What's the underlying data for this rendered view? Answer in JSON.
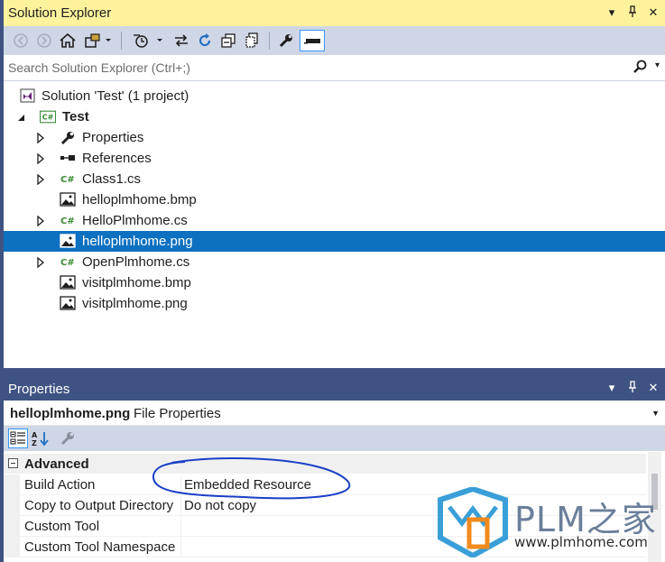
{
  "solution_explorer": {
    "title": "Solution Explorer",
    "search_placeholder": "Search Solution Explorer (Ctrl+;)",
    "tree": [
      {
        "label": "Solution 'Test' (1 project)",
        "icon": "solution-icon",
        "expandable": false,
        "bold": false,
        "selected": false
      },
      {
        "label": "Test",
        "icon": "csharp-project-icon",
        "expandable": true,
        "expanded": true,
        "bold": true,
        "selected": false
      },
      {
        "label": "Properties",
        "icon": "wrench-icon",
        "expandable": true,
        "bold": false,
        "selected": false
      },
      {
        "label": "References",
        "icon": "references-icon",
        "expandable": true,
        "bold": false,
        "selected": false
      },
      {
        "label": "Class1.cs",
        "icon": "csharp-file-icon",
        "expandable": true,
        "bold": false,
        "selected": false
      },
      {
        "label": "helloplmhome.bmp",
        "icon": "image-file-icon",
        "expandable": false,
        "bold": false,
        "selected": false
      },
      {
        "label": "HelloPlmhome.cs",
        "icon": "csharp-file-icon",
        "expandable": true,
        "bold": false,
        "selected": false
      },
      {
        "label": "helloplmhome.png",
        "icon": "image-file-icon",
        "expandable": false,
        "bold": false,
        "selected": true
      },
      {
        "label": "OpenPlmhome.cs",
        "icon": "csharp-file-icon",
        "expandable": true,
        "bold": false,
        "selected": false
      },
      {
        "label": "visitplmhome.bmp",
        "icon": "image-file-icon",
        "expandable": false,
        "bold": false,
        "selected": false
      },
      {
        "label": "visitplmhome.png",
        "icon": "image-file-icon",
        "expandable": false,
        "bold": false,
        "selected": false
      }
    ]
  },
  "properties": {
    "title": "Properties",
    "object_name": "helloplmhome.png",
    "object_type": "File Properties",
    "category": "Advanced",
    "rows": [
      {
        "name": "Build Action",
        "value": "Embedded Resource"
      },
      {
        "name": "Copy to Output Directory",
        "value": "Do not copy"
      },
      {
        "name": "Custom Tool",
        "value": ""
      },
      {
        "name": "Custom Tool Namespace",
        "value": ""
      }
    ]
  },
  "watermark": {
    "brand": "PLM之家",
    "url": "www.plmhome.com"
  },
  "colors": {
    "active_title": "#fff29d",
    "inactive_title": "#3f5382",
    "selection": "#0e70c0",
    "annotation": "#1a3fc7",
    "toolbar": "#cfd6e5"
  }
}
